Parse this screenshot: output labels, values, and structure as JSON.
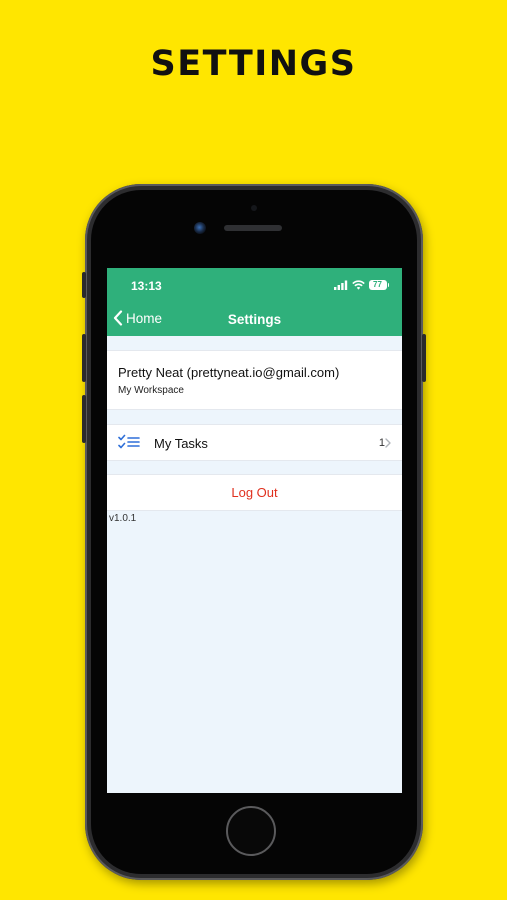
{
  "headline": "SETTINGS",
  "status_bar": {
    "time": "13:13",
    "battery": "77"
  },
  "navbar": {
    "back_label": "Home",
    "title": "Settings"
  },
  "account": {
    "name_email": "Pretty Neat (prettyneat.io@gmail.com)",
    "workspace": "My Workspace"
  },
  "tasks": {
    "label": "My Tasks",
    "count": "1",
    "icon": "checklist-icon"
  },
  "logout": {
    "label": "Log Out"
  },
  "version": "v1.0.1",
  "colors": {
    "background": "#FFE600",
    "navbar": "#2FB07B",
    "screen_bg": "#EDF5FC",
    "logout_text": "#E0301E",
    "task_icon": "#2E6FD8"
  }
}
